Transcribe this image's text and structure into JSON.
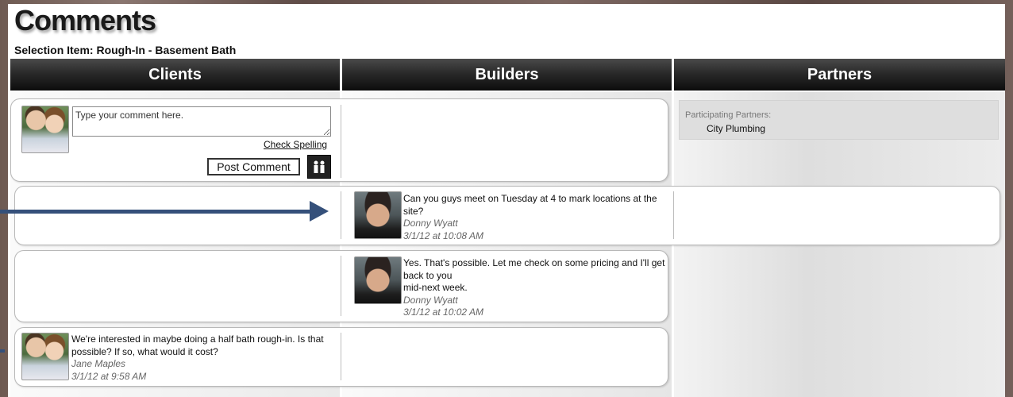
{
  "page": {
    "title": "Comments",
    "selection_item": "Selection Item: Rough-In - Basement Bath"
  },
  "columns": {
    "clients": "Clients",
    "builders": "Builders",
    "partners": "Partners"
  },
  "composer": {
    "placeholder": "Type your comment here.",
    "check_spelling": "Check Spelling",
    "post_button": "Post Comment",
    "people_icon": "people-icon"
  },
  "partners_panel": {
    "label": "Participating Partners:",
    "partner": "City Plumbing"
  },
  "comments": [
    {
      "column": "builders",
      "text": "Can you guys meet on Tuesday at 4 to mark locations at the site?",
      "author": "Donny Wyatt",
      "timestamp": "3/1/12 at 10:08 AM"
    },
    {
      "column": "builders",
      "text_line1": "Yes. That's possible. Let me check on some pricing and I'll get back to you",
      "text_line2": "mid-next week.",
      "author": "Donny Wyatt",
      "timestamp": "3/1/12 at 10:02 AM"
    },
    {
      "column": "clients",
      "text": "We're interested in maybe doing a half bath rough-in. Is that possible? If so, what would it cost?",
      "author": "Jane Maples",
      "timestamp": "3/1/12 at 9:58 AM"
    }
  ],
  "colors": {
    "header_bg": "#1a1a1a",
    "arrow": "#35507a",
    "meta_text": "#666666"
  }
}
